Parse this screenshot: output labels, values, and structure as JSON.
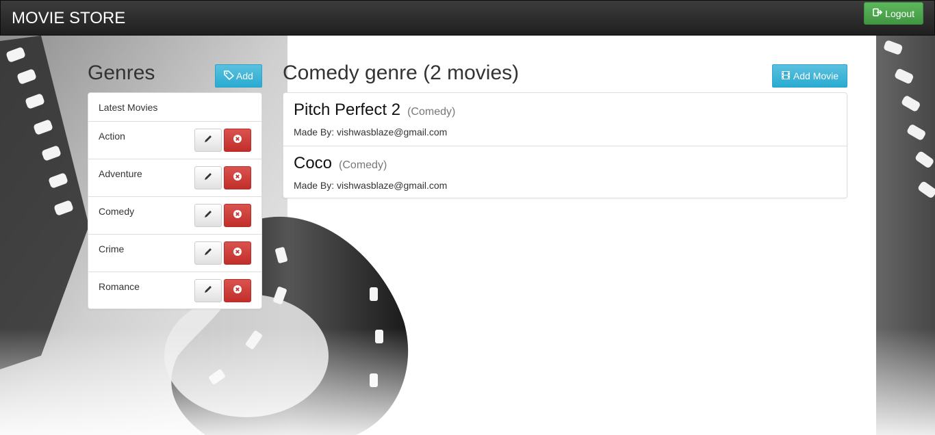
{
  "navbar": {
    "brand": "MOVIE STORE",
    "logout_label": "Logout"
  },
  "sidebar": {
    "title": "Genres",
    "add_label": "Add",
    "latest_label": "Latest Movies",
    "genres": [
      {
        "label": "Action"
      },
      {
        "label": "Adventure"
      },
      {
        "label": "Comedy"
      },
      {
        "label": "Crime"
      },
      {
        "label": "Romance"
      }
    ]
  },
  "main": {
    "title": "Comedy genre (2 movies)",
    "add_movie_label": "Add Movie",
    "movies": [
      {
        "name": "Pitch Perfect 2",
        "genre": "(Comedy)",
        "made_by_prefix": "Made By:",
        "made_by": "vishwasblaze@gmail.com"
      },
      {
        "name": "Coco",
        "genre": "(Comedy)",
        "made_by_prefix": "Made By:",
        "made_by": "vishwasblaze@gmail.com"
      }
    ]
  },
  "icons": {
    "logout": "logout-icon",
    "tag": "tag-icon",
    "film": "film-icon",
    "edit": "pencil-icon",
    "delete": "remove-circle-icon"
  },
  "colors": {
    "navbar": "#2a2a2a",
    "success": "#4cae4c",
    "info": "#31b0d5",
    "danger": "#c9302c"
  }
}
